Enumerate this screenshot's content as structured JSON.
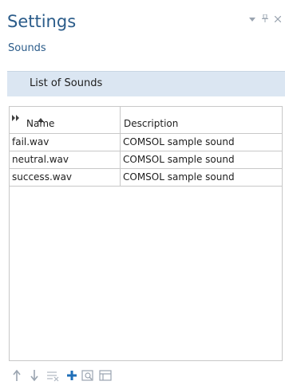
{
  "header": {
    "title": "Settings",
    "subtitle": "Sounds",
    "controls": [
      "pin-dropdown-icon",
      "pin-icon",
      "close-icon"
    ]
  },
  "section": {
    "title": "List of Sounds"
  },
  "table": {
    "columns": [
      "Name",
      "Description"
    ],
    "rows": [
      {
        "name": "fail.wav",
        "description": "COMSOL sample sound"
      },
      {
        "name": "neutral.wav",
        "description": "COMSOL sample sound"
      },
      {
        "name": "success.wav",
        "description": "COMSOL sample sound"
      }
    ]
  },
  "toolbar": {
    "buttons": [
      "move-up-icon",
      "move-down-icon",
      "delete-icon",
      "add-icon",
      "browse-icon",
      "load-from-file-icon"
    ]
  },
  "colors": {
    "accent": "#2b5c8a",
    "section_bg": "#dbe6f2",
    "border": "#c8c8c8",
    "add_icon": "#1f6fb8",
    "disabled_icon": "#9aa4b0"
  }
}
